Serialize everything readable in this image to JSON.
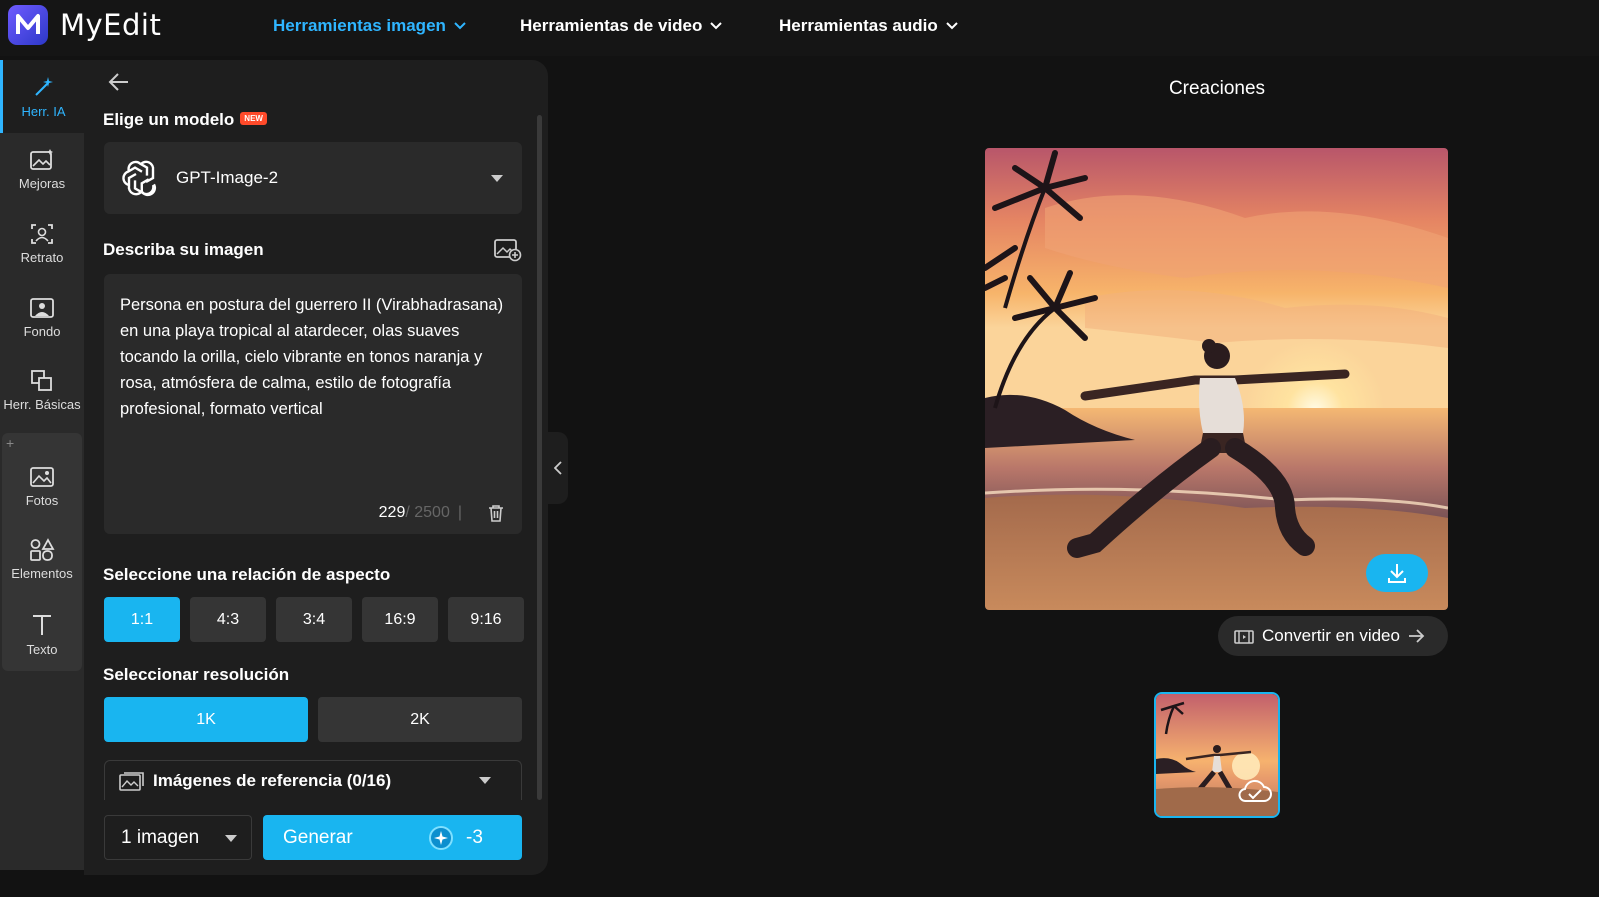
{
  "app": {
    "name": "MyEdit"
  },
  "topnav": {
    "items": [
      {
        "label": "Herramientas imagen",
        "active": true
      },
      {
        "label": "Herramientas de video",
        "active": false
      },
      {
        "label": "Herramientas audio",
        "active": false
      }
    ]
  },
  "rail": {
    "items": [
      {
        "label": "Herr. IA",
        "icon": "magic-wand-icon",
        "active": true
      },
      {
        "label": "Mejoras",
        "icon": "image-enhance-icon"
      },
      {
        "label": "Retrato",
        "icon": "portrait-icon"
      },
      {
        "label": "Fondo",
        "icon": "background-icon"
      },
      {
        "label": "Herr. Básicas",
        "icon": "basic-tools-icon"
      },
      {
        "label": "Fotos",
        "icon": "photos-icon"
      },
      {
        "label": "Elementos",
        "icon": "elements-icon"
      },
      {
        "label": "Texto",
        "icon": "text-icon"
      }
    ],
    "plus": "+"
  },
  "panel": {
    "model_title": "Elige un modelo",
    "new_badge": "NEW",
    "model_value": "GPT-Image-2",
    "describe_title": "Describa su imagen",
    "prompt": "Persona en postura del guerrero II (Virabhadrasana) en una playa tropical al atardecer, olas suaves tocando la orilla, cielo vibrante en tonos naranja y rosa, atmósfera de calma, estilo de fotografía profesional, formato vertical",
    "char_count": "229",
    "char_max": "/ 2500",
    "counter_sep": "|",
    "aspect_title": "Seleccione una relación de aspecto",
    "aspect_options": [
      "1:1",
      "4:3",
      "3:4",
      "16:9",
      "9:16"
    ],
    "aspect_selected": "1:1",
    "resolution_title": "Seleccionar resolución",
    "resolution_options": [
      "1K",
      "2K"
    ],
    "resolution_selected": "1K",
    "reference_label": "Imágenes de referencia (0/16)",
    "count_value": "1 imagen",
    "generate_label": "Generar",
    "generate_cost": "-3"
  },
  "creations": {
    "title": "Creaciones",
    "convert_label": "Convertir en video"
  },
  "colors": {
    "accent": "#19b5f0",
    "nav_active": "#2fb5ff",
    "badge": "#ff4a2a",
    "panel_bg": "#1e1e1e",
    "app_bg": "#121212"
  }
}
